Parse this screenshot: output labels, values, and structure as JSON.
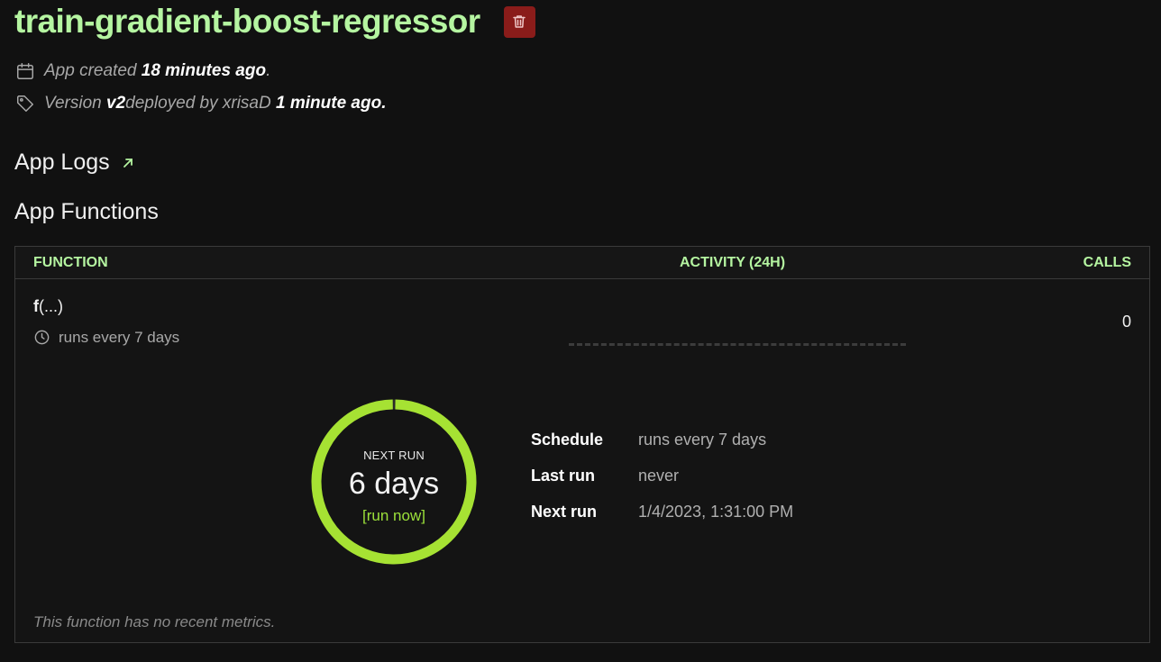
{
  "app": {
    "title": "train-gradient-boost-regressor",
    "delete_icon": "trash-icon"
  },
  "meta": {
    "created_prefix": "App created ",
    "created_time": "18 minutes ago",
    "created_suffix": ".",
    "version_prefix": "Version ",
    "version": "v2",
    "deployed_by_text": " deployed by xrisaD ",
    "deployed_time": "1 minute ago.",
    "calendar_icon": "calendar-icon",
    "tag_icon": "tag-icon"
  },
  "sections": {
    "logs_label": "App Logs",
    "logs_icon": "arrow-up-right-icon",
    "functions_label": "App Functions"
  },
  "table": {
    "headers": {
      "function": "FUNCTION",
      "activity": "ACTIVITY (24H)",
      "calls": "CALLS"
    },
    "row": {
      "name_bold": "f",
      "name_rest": "(...)",
      "schedule": "runs every 7 days",
      "calls": "0"
    }
  },
  "next_run": {
    "label": "NEXT RUN",
    "value": "6 days",
    "action": "[run now]",
    "progress_fraction": 1.0
  },
  "details": [
    {
      "label": "Schedule",
      "value": "runs every 7 days"
    },
    {
      "label": "Last run",
      "value": "never"
    },
    {
      "label": "Next run",
      "value": "1/4/2023, 1:31:00 PM"
    }
  ],
  "no_metrics": "This function has no recent metrics.",
  "colors": {
    "accent_green": "#b5f5a1",
    "ring_green": "#a6e233",
    "delete_red": "#8a1c1a",
    "background": "#111111"
  }
}
